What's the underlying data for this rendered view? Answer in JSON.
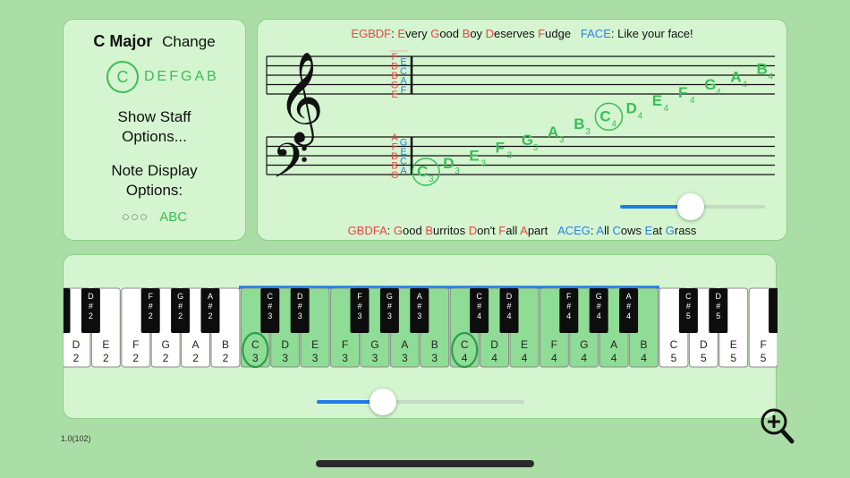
{
  "key_panel": {
    "key_name": "C Major",
    "change_label": "Change",
    "scale_root": "C",
    "scale_rest": "DEFGAB",
    "show_staff_line1": "Show Staff",
    "show_staff_line2": "Options...",
    "note_display_line1": "Note Display",
    "note_display_line2": "Options:",
    "display_dots": "○○○",
    "display_abc": "ABC"
  },
  "treble_mnemonic": {
    "lines": "EGBDF",
    "lines_words": [
      "E",
      "very ",
      "G",
      "ood ",
      "B",
      "oy ",
      "D",
      "eserves ",
      "F",
      "udge"
    ],
    "spaces": "FACE",
    "spaces_phrase": ": Like your face!"
  },
  "bass_mnemonic": {
    "lines": "GBDFA",
    "lines_words": [
      "G",
      "ood ",
      "B",
      "urritos ",
      "D",
      "on't ",
      "F",
      "all ",
      "A",
      "part"
    ],
    "spaces": "ACEG",
    "spaces_words": [
      "A",
      "ll ",
      "C",
      "ows ",
      "E",
      "at ",
      "G",
      "rass"
    ]
  },
  "treble_line_letters": [
    "F",
    "D",
    "B",
    "G",
    "E"
  ],
  "treble_space_letters": [
    "E",
    "C",
    "A",
    "F"
  ],
  "bass_line_letters": [
    "A",
    "F",
    "D",
    "B",
    "G"
  ],
  "bass_space_letters": [
    "G",
    "E",
    "C",
    "A"
  ],
  "staff_notes": [
    {
      "n": "C",
      "o": "3",
      "circled": true
    },
    {
      "n": "D",
      "o": "3"
    },
    {
      "n": "E",
      "o": "3"
    },
    {
      "n": "F",
      "o": "3"
    },
    {
      "n": "G",
      "o": "3"
    },
    {
      "n": "A",
      "o": "3"
    },
    {
      "n": "B",
      "o": "3"
    },
    {
      "n": "C",
      "o": "4",
      "circled": true
    },
    {
      "n": "D",
      "o": "4"
    },
    {
      "n": "E",
      "o": "4"
    },
    {
      "n": "F",
      "o": "4"
    },
    {
      "n": "G",
      "o": "4"
    },
    {
      "n": "A",
      "o": "4"
    },
    {
      "n": "B",
      "o": "4"
    }
  ],
  "staff_slider_value": 0.49,
  "piano": {
    "white_keys": [
      {
        "n": "D",
        "o": "2"
      },
      {
        "n": "E",
        "o": "2"
      },
      {
        "n": "F",
        "o": "2"
      },
      {
        "n": "G",
        "o": "2"
      },
      {
        "n": "A",
        "o": "2"
      },
      {
        "n": "B",
        "o": "2"
      },
      {
        "n": "C",
        "o": "3",
        "hl": true,
        "circled": true
      },
      {
        "n": "D",
        "o": "3",
        "hl": true
      },
      {
        "n": "E",
        "o": "3",
        "hl": true
      },
      {
        "n": "F",
        "o": "3",
        "hl": true
      },
      {
        "n": "G",
        "o": "3",
        "hl": true
      },
      {
        "n": "A",
        "o": "3",
        "hl": true
      },
      {
        "n": "B",
        "o": "3",
        "hl": true
      },
      {
        "n": "C",
        "o": "4",
        "hl": true,
        "circled": true
      },
      {
        "n": "D",
        "o": "4",
        "hl": true
      },
      {
        "n": "E",
        "o": "4",
        "hl": true
      },
      {
        "n": "F",
        "o": "4",
        "hl": true
      },
      {
        "n": "G",
        "o": "4",
        "hl": true
      },
      {
        "n": "A",
        "o": "4",
        "hl": true
      },
      {
        "n": "B",
        "o": "4",
        "hl": true
      },
      {
        "n": "C",
        "o": "5"
      },
      {
        "n": "D",
        "o": "5"
      },
      {
        "n": "E",
        "o": "5"
      },
      {
        "n": "F",
        "o": "5"
      }
    ],
    "black_keys": [
      {
        "label": "",
        "after": -1
      },
      {
        "label": "D#2",
        "after": 0
      },
      {
        "label": "F#2",
        "after": 2
      },
      {
        "label": "G#2",
        "after": 3
      },
      {
        "label": "A#2",
        "after": 4
      },
      {
        "label": "C#3",
        "after": 6
      },
      {
        "label": "D#3",
        "after": 7
      },
      {
        "label": "F#3",
        "after": 9
      },
      {
        "label": "G#3",
        "after": 10
      },
      {
        "label": "A#3",
        "after": 11
      },
      {
        "label": "C#4",
        "after": 13
      },
      {
        "label": "D#4",
        "after": 14
      },
      {
        "label": "F#4",
        "after": 16
      },
      {
        "label": "G#4",
        "after": 17
      },
      {
        "label": "A#4",
        "after": 18
      },
      {
        "label": "C#5",
        "after": 20
      },
      {
        "label": "D#5",
        "after": 21
      },
      {
        "label": "",
        "after": 23
      }
    ]
  },
  "piano_slider_value": 0.32,
  "version": "1.0(102)",
  "icons": {
    "treble": "treble-clef-icon",
    "bass": "bass-clef-icon",
    "zoom": "zoom-in-icon"
  },
  "colors": {
    "accent_green": "#3cbd57",
    "highlight_key": "#8fdc96",
    "red": "#e84545",
    "blue": "#2f7fe0",
    "slider_blue": "#1f7ce8"
  }
}
